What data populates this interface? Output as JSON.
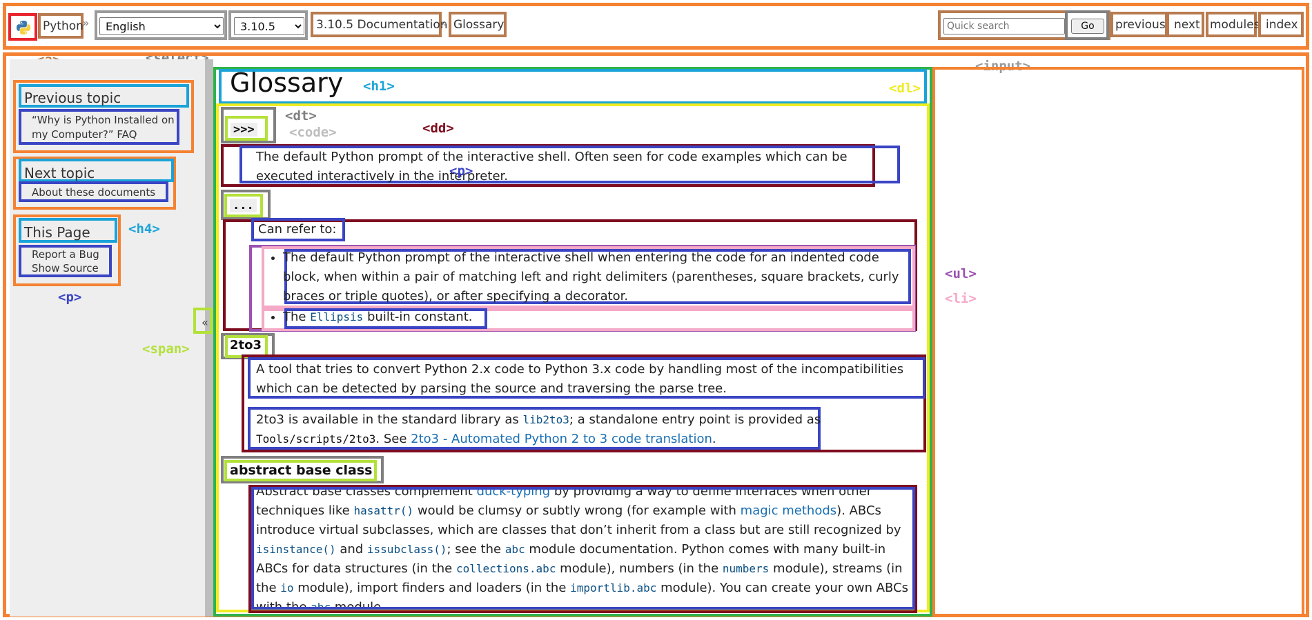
{
  "topbar": {
    "home": "Python",
    "sep": "»",
    "language": "English",
    "version": "3.10.5",
    "doc_crumb": "3.10.5 Documentation",
    "page_crumb": "Glossary",
    "search_placeholder": "Quick search",
    "go": "Go",
    "nav": [
      "previous",
      "next",
      "modules",
      "index"
    ]
  },
  "annotations": {
    "a": "<a>",
    "select": "<select>",
    "input": "<input>",
    "h1": "<h1>",
    "dl": "<dl>",
    "dt": "<dt>",
    "code": "<code>",
    "dd": "<dd>",
    "p": "<p>",
    "h4": "<h4>",
    "p2": "<p>",
    "span": "<span>",
    "ul": "<ul>",
    "li": "<li>"
  },
  "colors": {
    "outer": "#f58232",
    "link": "#1a6fb3",
    "sidebar_bg": "#eeeeee"
  },
  "sidebar": {
    "prev_heading": "Previous topic",
    "prev_link": "“Why is Python Installed on my Computer?” FAQ",
    "next_heading": "Next topic",
    "next_link": "About these documents",
    "this_heading": "This Page",
    "report": "Report a Bug",
    "source": "Show Source",
    "collapse": "«"
  },
  "main": {
    "title": "Glossary",
    "t1": ">>>",
    "d1": "The default Python prompt of the interactive shell. Often seen for code examples which can be executed interactively in the interpreter.",
    "t2": "...",
    "d2_intro": "Can refer to:",
    "d2_li1": "The default Python prompt of the interactive shell when entering the code for an indented code block, when within a pair of matching left and right delimiters (parentheses, square brackets, curly braces or triple quotes), or after specifying a decorator.",
    "d2_li2_pre": "The ",
    "d2_li2_code": "Ellipsis",
    "d2_li2_post": " built-in constant.",
    "t3": "2to3",
    "d3_p1": "A tool that tries to convert Python 2.x code to Python 3.x code by handling most of the incompatibilities which can be detected by parsing the source and traversing the parse tree.",
    "d3_p2_a": "2to3 is available in the standard library as ",
    "d3_p2_code1": "lib2to3",
    "d3_p2_b": "; a standalone entry point is provided as ",
    "d3_p2_code2": "Tools/scripts/2to3",
    "d3_p2_c": ". See ",
    "d3_p2_link": "2to3 - Automated Python 2 to 3 code translation",
    "d3_p2_d": ".",
    "t4": "abstract base class",
    "d4": {
      "s1": "Abstract base classes complement ",
      "l1": "duck-typing",
      "s2": " by providing a way to define interfaces when other techniques like ",
      "c1": "hasattr()",
      "s3": " would be clumsy or subtly wrong (for example with ",
      "l2": "magic methods",
      "s4": "). ABCs introduce virtual subclasses, which are classes that don’t inherit from a class but are still recognized by ",
      "c2": "isinstance()",
      "s5": " and ",
      "c3": "issubclass()",
      "s6": "; see the ",
      "c4": "abc",
      "s7": " module documentation. Python comes with many built-in ABCs for data structures (in the ",
      "c5": "collections.abc",
      "s8": " module), numbers (in the ",
      "c6": "numbers",
      "s9": " module), streams (in the ",
      "c7": "io",
      "s10": " module), import finders and loaders (in the ",
      "c8": "importlib.abc",
      "s11": " module). You can create your own ABCs with the ",
      "c9": "abc",
      "s12": " module."
    }
  }
}
